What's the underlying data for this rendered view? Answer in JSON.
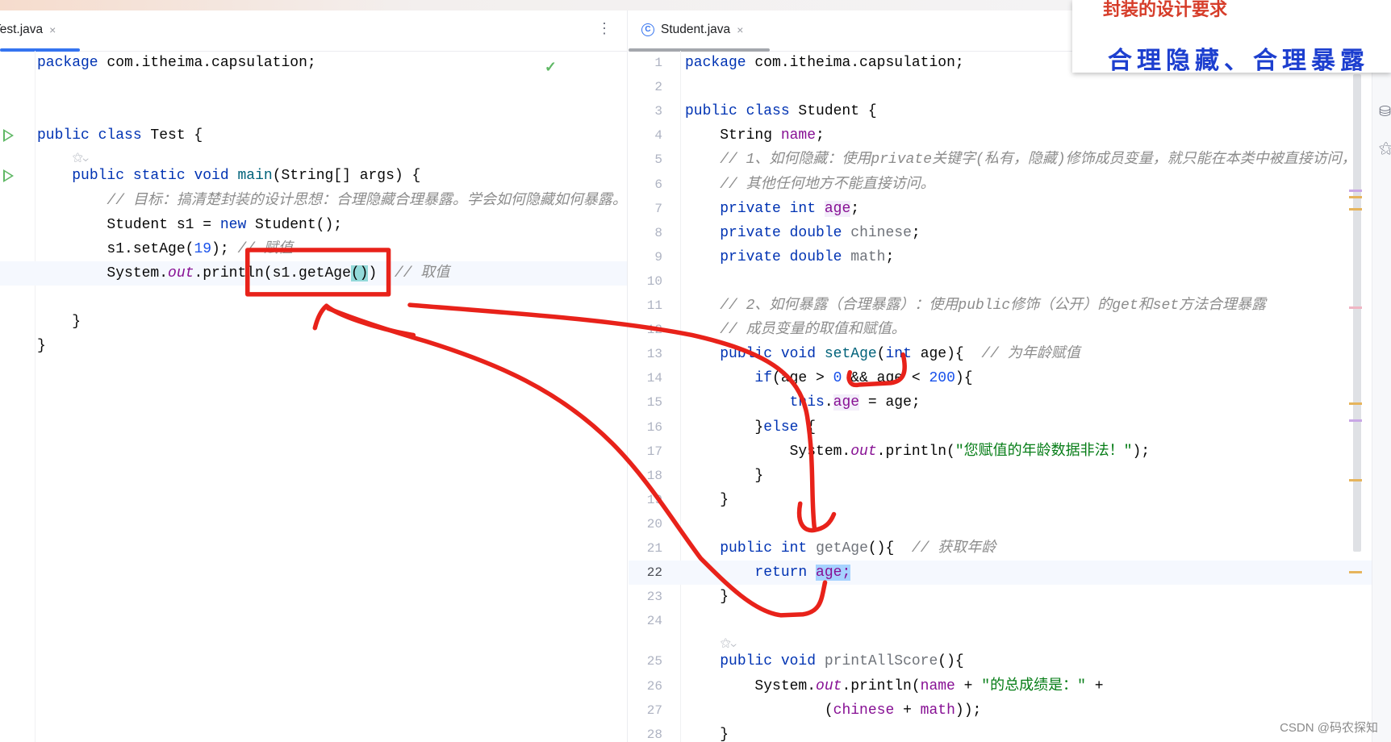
{
  "overlay": {
    "title": "封装的设计要求",
    "subtitle": "合理隐藏、合理暴露"
  },
  "watermark": "CSDN @码农探知",
  "left_editor": {
    "tab": {
      "label": "Test.java",
      "close": "×",
      "active": true
    },
    "menu_icon": "⋮",
    "status_icon": "✓",
    "hint_glyph": "⚝⌄",
    "lines": [
      {
        "tokens": [
          [
            "package",
            "kw"
          ],
          [
            " com.itheima.capsulation;",
            ""
          ]
        ]
      },
      {
        "tokens": []
      },
      {
        "tokens": []
      },
      {
        "run": true,
        "tokens": [
          [
            "public class",
            "kw"
          ],
          [
            " Test {",
            ""
          ]
        ]
      },
      {
        "hint_before": true,
        "run": true,
        "tokens": [
          [
            "    ",
            ""
          ],
          [
            "public static void",
            "kw"
          ],
          [
            " ",
            ""
          ],
          [
            "main",
            "fn"
          ],
          [
            "(String[] args) {",
            ""
          ]
        ]
      },
      {
        "tokens": [
          [
            "        ",
            ""
          ],
          [
            "// 目标：搞清楚封装的设计思想：合理隐藏合理暴露。学会如何隐藏如何暴露。",
            "cm"
          ]
        ]
      },
      {
        "tokens": [
          [
            "        Student s1 = ",
            ""
          ],
          [
            "new",
            "kw"
          ],
          [
            " Student();",
            ""
          ]
        ]
      },
      {
        "tokens": [
          [
            "        s1.setAge(",
            ""
          ],
          [
            "19",
            "num"
          ],
          [
            "); ",
            ""
          ],
          [
            "// 赋值",
            "cm"
          ]
        ]
      },
      {
        "current": true,
        "tokens": [
          [
            "        System.",
            ""
          ],
          [
            "out",
            "st"
          ],
          [
            ".println(s1.getAge",
            ""
          ],
          [
            "()",
            "hl-brace"
          ],
          [
            ")",
            ""
          ],
          [
            "  ",
            ""
          ],
          [
            "// 取值",
            "cm"
          ]
        ]
      },
      {
        "tokens": []
      },
      {
        "tokens": [
          [
            "    }",
            ""
          ]
        ]
      },
      {
        "tokens": [
          [
            "}",
            ""
          ]
        ]
      }
    ]
  },
  "right_editor": {
    "tab": {
      "label": "Student.java",
      "close": "×",
      "icon": "C",
      "active": false
    },
    "hint_glyph": "⚝⌄",
    "lines": [
      {
        "n": "1",
        "tokens": [
          [
            "package",
            "kw"
          ],
          [
            " com.itheima.capsulation;",
            ""
          ]
        ]
      },
      {
        "n": "2",
        "tokens": []
      },
      {
        "n": "3",
        "tokens": [
          [
            "public class",
            "kw"
          ],
          [
            " Student {",
            ""
          ]
        ]
      },
      {
        "n": "4",
        "tokens": [
          [
            "    String ",
            ""
          ],
          [
            "name",
            "fld"
          ],
          [
            ";",
            ""
          ]
        ]
      },
      {
        "n": "5",
        "tokens": [
          [
            "    ",
            ""
          ],
          [
            "// 1、如何隐藏：使用private关键字(私有，隐藏)修饰成员变量，就只能在本类中被直接访问，",
            "cm"
          ]
        ]
      },
      {
        "n": "6",
        "tokens": [
          [
            "    ",
            ""
          ],
          [
            "// 其他任何地方不能直接访问。",
            "cm"
          ]
        ]
      },
      {
        "n": "7",
        "tokens": [
          [
            "    ",
            ""
          ],
          [
            "private int",
            "kw"
          ],
          [
            " ",
            ""
          ],
          [
            "age",
            "fld hl-field"
          ],
          [
            ";",
            ""
          ]
        ]
      },
      {
        "n": "8",
        "tokens": [
          [
            "    ",
            ""
          ],
          [
            "private double",
            "kw"
          ],
          [
            " ",
            ""
          ],
          [
            "chinese",
            "unused"
          ],
          [
            ";",
            ""
          ]
        ]
      },
      {
        "n": "9",
        "tokens": [
          [
            "    ",
            ""
          ],
          [
            "private double",
            "kw"
          ],
          [
            " ",
            ""
          ],
          [
            "math",
            "unused"
          ],
          [
            ";",
            ""
          ]
        ]
      },
      {
        "n": "10",
        "tokens": []
      },
      {
        "n": "11",
        "tokens": [
          [
            "    ",
            ""
          ],
          [
            "// 2、如何暴露（合理暴露）：使用public修饰（公开）的get和set方法合理暴露",
            "cm"
          ]
        ]
      },
      {
        "n": "12",
        "tokens": [
          [
            "    ",
            ""
          ],
          [
            "// 成员变量的取值和赋值。",
            "cm"
          ]
        ]
      },
      {
        "n": "13",
        "tokens": [
          [
            "    ",
            ""
          ],
          [
            "public void",
            "kw"
          ],
          [
            " ",
            ""
          ],
          [
            "setAge",
            "fn"
          ],
          [
            "(",
            ""
          ],
          [
            "int",
            "kw"
          ],
          [
            " age){  ",
            ""
          ],
          [
            "// 为年龄赋值",
            "cm"
          ]
        ]
      },
      {
        "n": "14",
        "tokens": [
          [
            "        ",
            ""
          ],
          [
            "if",
            "kw"
          ],
          [
            "(age > ",
            ""
          ],
          [
            "0",
            "num"
          ],
          [
            " && age < ",
            ""
          ],
          [
            "200",
            "num"
          ],
          [
            "){",
            ""
          ]
        ]
      },
      {
        "n": "15",
        "tokens": [
          [
            "            ",
            ""
          ],
          [
            "this",
            "kw"
          ],
          [
            ".",
            ""
          ],
          [
            "age",
            "fld hl-field"
          ],
          [
            " = age;",
            ""
          ]
        ]
      },
      {
        "n": "16",
        "tokens": [
          [
            "        }",
            ""
          ],
          [
            "else",
            "kw"
          ],
          [
            " {",
            ""
          ]
        ]
      },
      {
        "n": "17",
        "tokens": [
          [
            "            System.",
            ""
          ],
          [
            "out",
            "st"
          ],
          [
            ".println(",
            ""
          ],
          [
            "\"您赋值的年龄数据非法！\"",
            "str"
          ],
          [
            ");",
            ""
          ]
        ]
      },
      {
        "n": "18",
        "tokens": [
          [
            "        }",
            ""
          ]
        ]
      },
      {
        "n": "19",
        "tokens": [
          [
            "    }",
            ""
          ]
        ]
      },
      {
        "n": "20",
        "tokens": []
      },
      {
        "n": "21",
        "tokens": [
          [
            "    ",
            ""
          ],
          [
            "public int",
            "kw"
          ],
          [
            " ",
            ""
          ],
          [
            "getAge",
            "unused"
          ],
          [
            "(){  ",
            ""
          ],
          [
            "// 获取年龄",
            "cm"
          ]
        ]
      },
      {
        "n": "22",
        "current": true,
        "tokens": [
          [
            "        ",
            ""
          ],
          [
            "return",
            "kw"
          ],
          [
            " ",
            ""
          ],
          [
            "age;",
            "fld hl-sel"
          ]
        ]
      },
      {
        "n": "23",
        "tokens": [
          [
            "    }",
            ""
          ]
        ]
      },
      {
        "n": "24",
        "tokens": []
      },
      {
        "n": "25",
        "hint_before": true,
        "tokens": [
          [
            "    ",
            ""
          ],
          [
            "public void",
            "kw"
          ],
          [
            " ",
            ""
          ],
          [
            "printAllScore",
            "unused"
          ],
          [
            "(){",
            ""
          ]
        ]
      },
      {
        "n": "26",
        "tokens": [
          [
            "        System.",
            ""
          ],
          [
            "out",
            "st"
          ],
          [
            ".println(",
            ""
          ],
          [
            "name",
            "fld"
          ],
          [
            " + ",
            ""
          ],
          [
            "\"的总成绩是：\"",
            "str"
          ],
          [
            " +",
            ""
          ]
        ]
      },
      {
        "n": "27",
        "tokens": [
          [
            "                (",
            ""
          ],
          [
            "chinese",
            "fld"
          ],
          [
            " + ",
            ""
          ],
          [
            "math",
            "fld"
          ],
          [
            "));",
            ""
          ]
        ]
      },
      {
        "n": "28",
        "tokens": [
          [
            "    }",
            ""
          ]
        ]
      }
    ]
  },
  "colors": {
    "annotation": "#e8221a",
    "tab_active": "#3574f0",
    "keyword": "#0033b3",
    "comment": "#8c8c8c",
    "string": "#067d17"
  }
}
